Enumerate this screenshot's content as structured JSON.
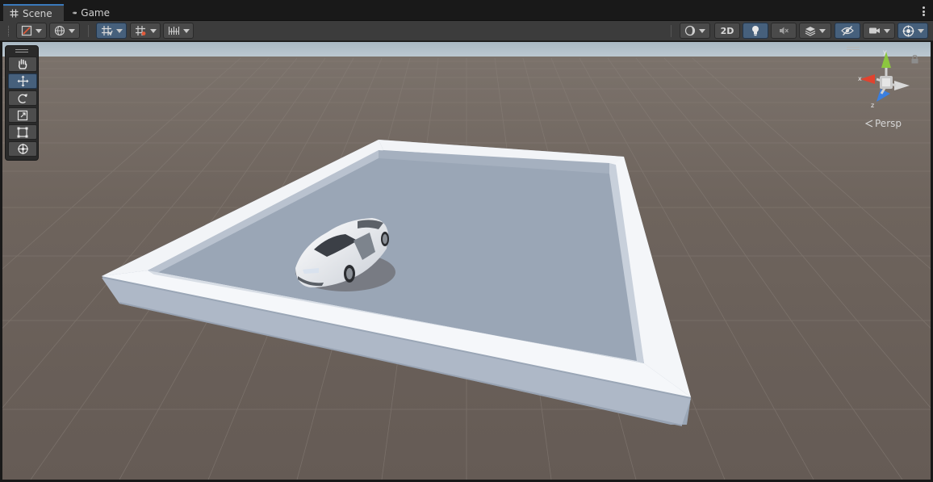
{
  "tabs": [
    {
      "label": "Scene",
      "icon": "grid-hash-icon",
      "active": true
    },
    {
      "label": "Game",
      "icon": "gamepad-icon",
      "active": false
    }
  ],
  "toolbar": {
    "left_tools": [
      "draw-mode-icon",
      "global-pivot-icon",
      "grid-snap-icon",
      "increment-snap-icon",
      "ruler-grid-icon"
    ],
    "right_tools": [
      "shading-mode-icon",
      "toggle-2d",
      "lighting-icon",
      "audio-mute-icon",
      "effects-icon",
      "hidden-objects-icon",
      "camera-icon",
      "gizmos-icon"
    ],
    "mode_2d_label": "2D"
  },
  "tools_panel": {
    "tools": [
      "hand-tool",
      "move-tool",
      "rotate-tool",
      "scale-tool",
      "rect-tool",
      "transform-tool"
    ],
    "active_tool": "move-tool"
  },
  "gizmo": {
    "projection_label": "Persp",
    "axis_x": "x",
    "axis_y": "y",
    "axis_z": "z",
    "colors": {
      "x": "#e0432f",
      "y": "#8cc63f",
      "z": "#3a7fe0"
    }
  },
  "colors": {
    "accent": "#3a79bb",
    "active_button": "#46607c",
    "ground": "#6b615b",
    "sky": "#b7c5cf",
    "wall_top": "#f4f6f9",
    "wall_side": "#aab4c4"
  }
}
